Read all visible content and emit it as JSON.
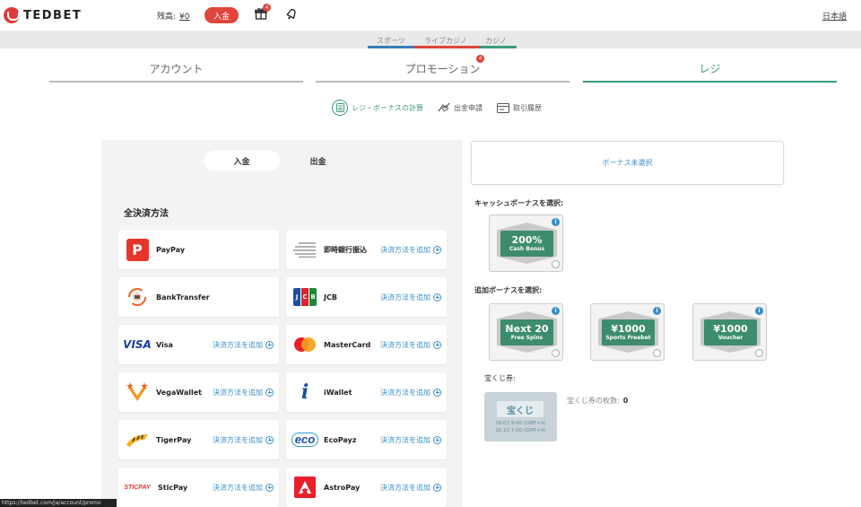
{
  "header": {
    "logo_text": "TEDBET",
    "balance_label": "残高:",
    "balance_amount": "¥0",
    "deposit_label": "入金",
    "gift_badge": "4",
    "language": "日本語"
  },
  "subnav": {
    "items": [
      "スポーツ",
      "ライブカジノ",
      "カジノ"
    ],
    "colors": [
      "#3a7bb8",
      "#e0443a",
      "#3d9a80"
    ]
  },
  "tabs": {
    "items": [
      "アカウント",
      "プロモーション",
      "レジ"
    ],
    "promo_badge": "4",
    "active_index": 2
  },
  "subtabs": [
    "レジ・ボーナスの計算",
    "出金申請",
    "取引履歴"
  ],
  "payment": {
    "toggle": [
      "入金",
      "出金"
    ],
    "heading": "全決済方法",
    "add_label": "決済方法を追加",
    "methods": [
      {
        "name": "PayPay",
        "icon": "paypay-icon"
      },
      {
        "name": "即時銀行振込",
        "icon": "instant-bank-icon"
      },
      {
        "name": "BankTransfer",
        "icon": "bank-transfer-icon"
      },
      {
        "name": "JCB",
        "icon": "jcb-icon"
      },
      {
        "name": "Visa",
        "icon": "visa-icon",
        "logo": "VISA"
      },
      {
        "name": "MasterCard",
        "icon": "mastercard-icon"
      },
      {
        "name": "VegaWallet",
        "icon": "vegawallet-icon"
      },
      {
        "name": "iWallet",
        "icon": "iwallet-icon"
      },
      {
        "name": "TigerPay",
        "icon": "tigerpay-icon"
      },
      {
        "name": "EcoPayz",
        "icon": "ecopayz-icon",
        "logo": "eco"
      },
      {
        "name": "SticPay",
        "icon": "sticpay-icon",
        "logo": "STICPAY"
      },
      {
        "name": "AstroPay",
        "icon": "astropay-icon"
      }
    ]
  },
  "bonus": {
    "unselected": "ボーナス未選択",
    "cash_label": "キャッシュボーナスを選択:",
    "cash": {
      "main": "200%",
      "sub": "Cash Bonus"
    },
    "additional_label": "追加ボーナスを選択:",
    "additional": [
      {
        "main": "Next 20",
        "sub": "Free Spins"
      },
      {
        "main": "¥1000",
        "sub": "Sports Freebet"
      },
      {
        "main": "¥1000",
        "sub": "Voucher"
      }
    ],
    "info_glyph": "i"
  },
  "lottery": {
    "label": "宝くじ券:",
    "ticket_title": "宝くじ",
    "date1": "10.03 9:00 (GMT+9)",
    "date2": "10.10 7:00 (GMT+9)",
    "count_label": "宝くじ券の枚数:",
    "count": "0"
  },
  "statusbar": "https://tedbet.com/ja/account/promo"
}
